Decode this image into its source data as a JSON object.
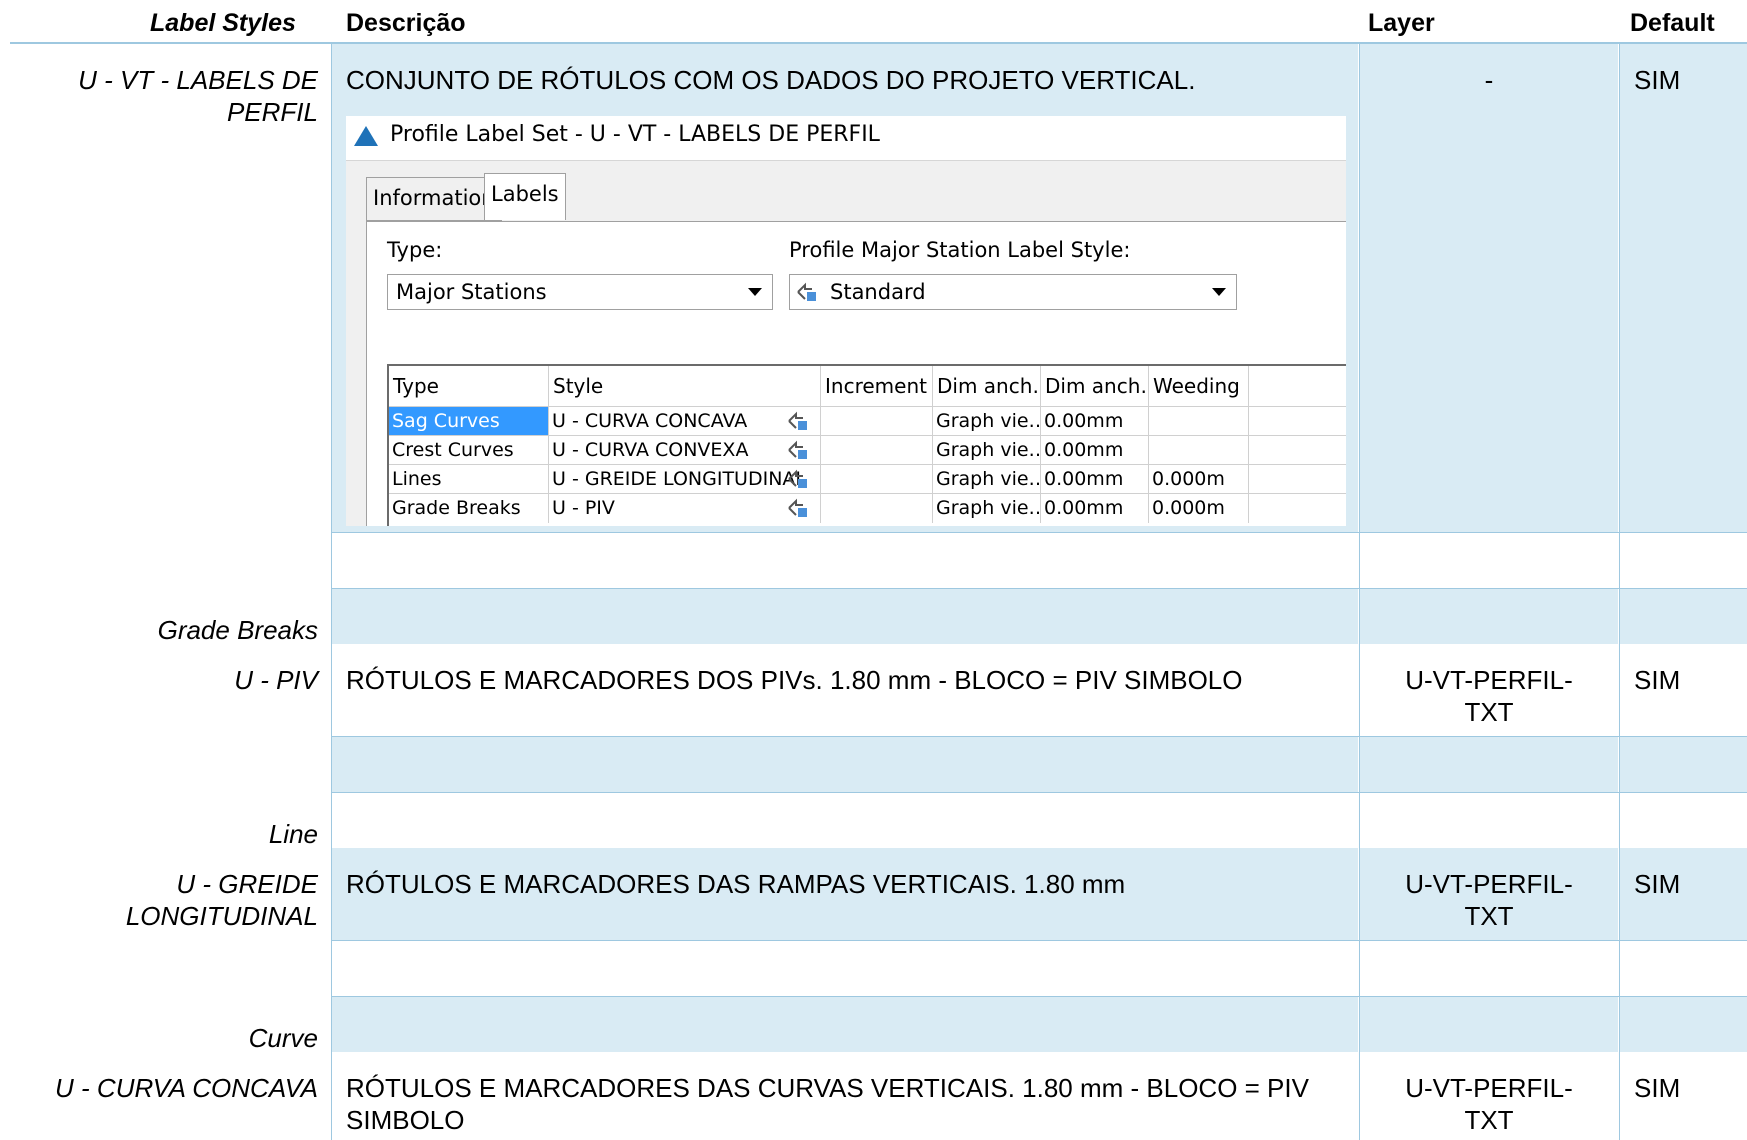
{
  "header": {
    "col_label": "Label Styles",
    "col_desc": "Descrição",
    "col_layer": "Layer",
    "col_default": "Default"
  },
  "rows": [
    {
      "label": "U - VT - LABELS DE PERFIL",
      "desc": "CONJUNTO DE RÓTULOS COM OS DADOS DO PROJETO VERTICAL.",
      "layer": "-",
      "default": "SIM"
    },
    {
      "label": "Grade Breaks"
    },
    {
      "label": "U - PIV",
      "desc": "RÓTULOS E MARCADORES DOS PIVs. 1.80 mm - BLOCO = PIV SIMBOLO",
      "layer": "U-VT-PERFIL-TXT",
      "default": "SIM"
    },
    {
      "label": "Line"
    },
    {
      "label": "U - GREIDE LONGITUDINAL",
      "desc": "RÓTULOS E MARCADORES DAS RAMPAS VERTICAIS. 1.80 mm",
      "layer": "U-VT-PERFIL-TXT",
      "default": "SIM"
    },
    {
      "label": "Curve"
    },
    {
      "label": "U - CURVA CONCAVA",
      "desc": "RÓTULOS E MARCADORES DAS CURVAS VERTICAIS.  1.80 mm - BLOCO = PIV SIMBOLO",
      "layer": "U-VT-PERFIL-TXT",
      "default": "SIM"
    }
  ],
  "dialog": {
    "title": "Profile Label Set - U - VT - LABELS DE PERFIL",
    "tabs": [
      "Information",
      "Labels"
    ],
    "type_label": "Type:",
    "type_value": "Major Stations",
    "style_label": "Profile Major Station Label Style:",
    "style_value": "Standard",
    "columns": [
      "Type",
      "Style",
      "Increment",
      "Dim anch…",
      "Dim anch…",
      "Weeding"
    ],
    "grid_rows": [
      {
        "type": "Sag Curves",
        "style": "U - CURVA CONCAVA",
        "increment": "",
        "dim1": "Graph vie…",
        "dim2": "0.00mm",
        "weeding": ""
      },
      {
        "type": "Crest Curves",
        "style": "U - CURVA CONVEXA",
        "increment": "",
        "dim1": "Graph vie…",
        "dim2": "0.00mm",
        "weeding": ""
      },
      {
        "type": "Lines",
        "style": "U - GREIDE LONGITUDINAL",
        "increment": "",
        "dim1": "Graph vie…",
        "dim2": "0.00mm",
        "weeding": "0.000m"
      },
      {
        "type": "Grade Breaks",
        "style": "U - PIV",
        "increment": "",
        "dim1": "Graph vie…",
        "dim2": "0.00mm",
        "weeding": "0.000m"
      }
    ]
  },
  "colors": {
    "row_shade": "#d9ebf4",
    "rule": "#9ec8e0",
    "selection": "#3399ff",
    "logo": "#1f72b8"
  }
}
